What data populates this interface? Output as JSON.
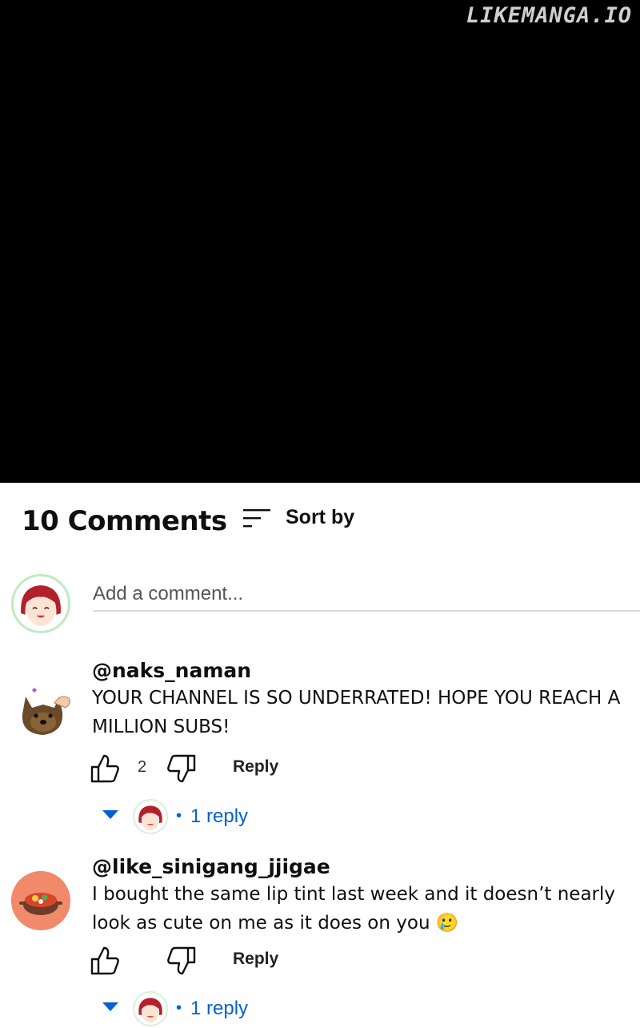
{
  "watermark": "LIKEMANGA.IO",
  "comments_header": {
    "count_label": "10 Comments",
    "sort_label": "Sort by"
  },
  "add_comment": {
    "placeholder": "Add a comment..."
  },
  "comments": [
    {
      "author": "@naks_naman",
      "text": "YOUR CHANNEL IS SO UNDERRATED! HOPE YOU REACH A MILLION SUBS!",
      "likes": "2",
      "reply_label": "Reply",
      "replies_label": "1 reply"
    },
    {
      "author": "@like_sinigang_jjigae",
      "text": "I bought the same lip tint last week and it doesn’t nearly look as cute on me as it does on you 🥲",
      "likes": "",
      "reply_label": "Reply",
      "replies_label": "1 reply"
    }
  ],
  "colors": {
    "link": "#065fd4",
    "avatar_ring": "#bfeac0",
    "food_avatar_bg": "#f08a6a"
  },
  "icons": [
    "sort-icon",
    "thumbs-up-icon",
    "thumbs-down-icon",
    "caret-down-icon"
  ]
}
